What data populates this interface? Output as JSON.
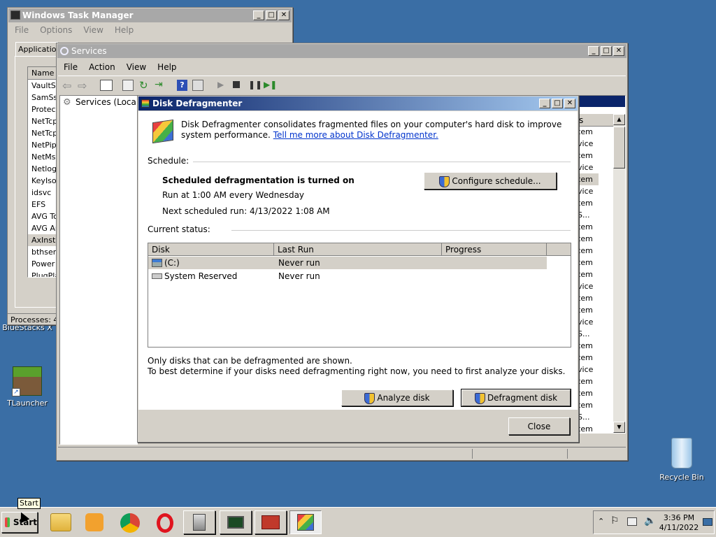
{
  "desktop": {
    "icons": [
      {
        "label": "BlueStacks X"
      },
      {
        "label": "TLauncher"
      },
      {
        "label": "Recycle Bin"
      }
    ]
  },
  "taskmgr": {
    "title": "Windows Task Manager",
    "menu": [
      "File",
      "Options",
      "View",
      "Help"
    ],
    "tab": "Applications",
    "column": "Name",
    "rows": [
      "VaultSvc",
      "SamSs",
      "Protect",
      "NetTcpl",
      "NetTcpl",
      "NetPipe",
      "NetMsm",
      "Netlogo",
      "KeyIso",
      "idsvc",
      "EFS",
      "AVG To",
      "AVG An",
      "AxInstS",
      "bthserv",
      "Power",
      "PlugPla"
    ],
    "status": "Processes: 46"
  },
  "services": {
    "title": "Services",
    "menu": [
      "File",
      "Action",
      "View",
      "Help"
    ],
    "tree_item": "Services (Local)",
    "column_tail": "s",
    "right_rows": [
      "tem",
      "vice",
      "tem",
      "vice",
      "tem",
      "vice",
      "tem",
      "S...",
      "tem",
      "tem",
      "tem",
      "tem",
      "tem",
      "vice",
      "tem",
      "tem",
      "vice",
      "S...",
      "tem",
      "tem",
      "vice",
      "tem",
      "tem",
      "tem",
      "S...",
      "tem"
    ]
  },
  "defrag": {
    "title": "Disk Defragmenter",
    "intro": "Disk Defragmenter consolidates fragmented files on your computer's hard disk to improve system performance.",
    "link": "Tell me more about Disk Defragmenter.",
    "schedule_label": "Schedule:",
    "schedule_status": "Scheduled defragmentation is turned on",
    "run_at": "Run at 1:00 AM every Wednesday",
    "next_run": "Next scheduled run: 4/13/2022 1:08 AM",
    "configure_button": "Configure schedule...",
    "current_status_label": "Current status:",
    "columns": [
      "Disk",
      "Last Run",
      "Progress"
    ],
    "disks": [
      {
        "name": "(C:)",
        "last_run": "Never run"
      },
      {
        "name": "System Reserved",
        "last_run": "Never run"
      }
    ],
    "note1": "Only disks that can be defragmented are shown.",
    "note2": "To best determine if your disks need defragmenting right now, you need to first analyze your disks.",
    "analyze_button": "Analyze disk",
    "defragment_button": "Defragment disk",
    "close_button": "Close"
  },
  "taskbar": {
    "start_label": "Start",
    "tooltip": "Start",
    "time": "3:36 PM",
    "date": "4/11/2022"
  }
}
